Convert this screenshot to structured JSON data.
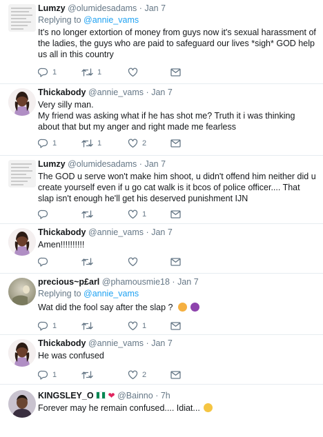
{
  "tweets": [
    {
      "name": "Lumzy",
      "handle": "@olumidesadams",
      "sep": "·",
      "date": "Jan 7",
      "replying_prefix": "Replying to ",
      "replying_to": "@annie_vams",
      "lines": [
        "It's no longer extortion of money from guys now it's sexual harassment of the ladies, the guys who are paid to safeguard our lives *sigh* GOD help us all in this country"
      ],
      "reply_count": "1",
      "retweet_count": "1",
      "like_count": ""
    },
    {
      "name": "Thickabody",
      "handle": "@annie_vams",
      "sep": "·",
      "date": "Jan 7",
      "lines": [
        "Very silly man.",
        "My friend was asking what if he has shot me? Truth it i was thinking about that but my anger and right made me fearless"
      ],
      "reply_count": "1",
      "retweet_count": "1",
      "like_count": "2"
    },
    {
      "name": "Lumzy",
      "handle": "@olumidesadams",
      "sep": "·",
      "date": "Jan 7",
      "lines": [
        "The GOD u serve won't make him shoot, u didn't offend him neither did u create yourself even if u go cat walk is it bcos of police officer.... That slap isn't enough he'll get his deserved punishment IJN"
      ],
      "reply_count": "",
      "retweet_count": "",
      "like_count": "1"
    },
    {
      "name": "Thickabody",
      "handle": "@annie_vams",
      "sep": "·",
      "date": "Jan 7",
      "lines": [
        "Amen!!!!!!!!!!"
      ],
      "reply_count": "",
      "retweet_count": "",
      "like_count": ""
    },
    {
      "name": "precious~p£arl",
      "handle": "@phamousmie18",
      "sep": "·",
      "date": "Jan 7",
      "replying_prefix": "Replying to ",
      "replying_to": "@annie_vams",
      "lines": [
        "Wat did the fool say after the slap ?"
      ],
      "reply_count": "1",
      "retweet_count": "",
      "like_count": "1"
    },
    {
      "name": "Thickabody",
      "handle": "@annie_vams",
      "sep": "·",
      "date": "Jan 7",
      "lines": [
        "He was confused"
      ],
      "reply_count": "1",
      "retweet_count": "",
      "like_count": "2"
    },
    {
      "name": "KINGSLEY_O",
      "handle": "@Bainno",
      "sep": "·",
      "date": "7h",
      "lines": [
        "Forever may he remain confused.... Idiat..."
      ]
    }
  ],
  "colors": {
    "link": "#1da1f2",
    "secondary_text": "#657786",
    "divider": "#e6ecf0"
  },
  "icons": {
    "reply": "reply-icon",
    "retweet": "retweet-icon",
    "like": "heart-icon",
    "dm": "envelope-icon"
  }
}
